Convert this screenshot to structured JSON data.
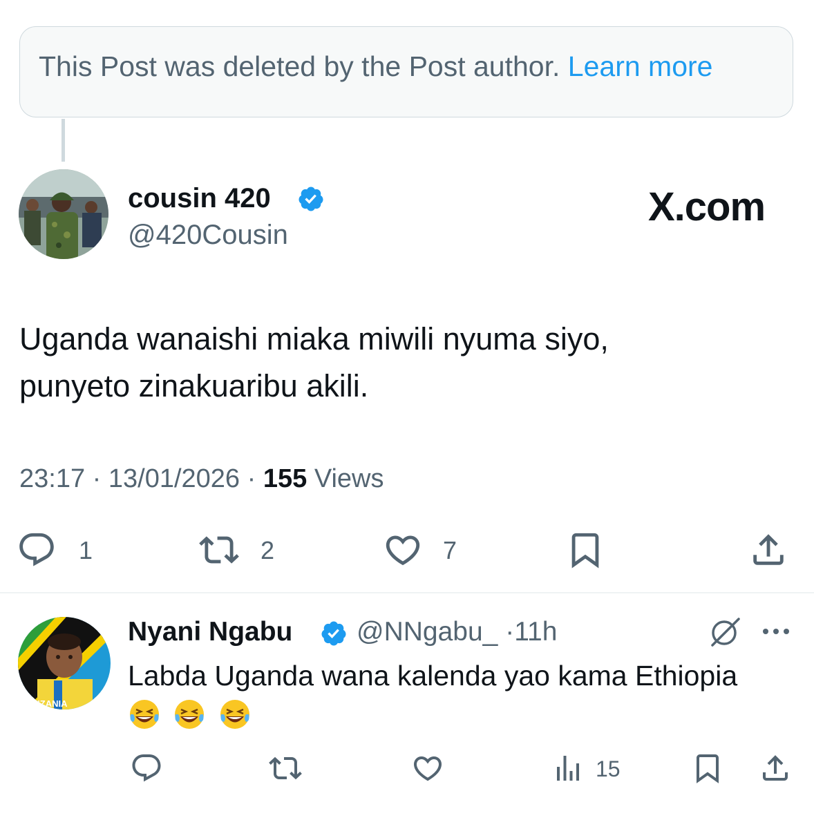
{
  "deleted_banner": {
    "text": "This Post was deleted by the Post author.",
    "link": "Learn more"
  },
  "brand": {
    "label": "X.com"
  },
  "post": {
    "display_name": "cousin 420",
    "handle": "@420Cousin",
    "text_line1": "Uganda wanaishi miaka miwili nyuma siyo,",
    "text_line2": "punyeto zinakuaribu akili.",
    "time": "23:17",
    "date": "13/01/2026",
    "views_count": "155",
    "views_label": "Views",
    "separator": "·",
    "actions": {
      "reply_count": "1",
      "repost_count": "2",
      "like_count": "7"
    }
  },
  "reply": {
    "display_name": "Nyani Ngabu",
    "handle": "@NNgabu_",
    "separator": "·",
    "time": "11h",
    "text": "Labda Uganda wana kalenda yao kama Ethiopia",
    "emoji_count": 3,
    "views_count": "15",
    "avatar_text": "TANZANIA"
  },
  "colors": {
    "accent": "#1d9bf0",
    "text_primary": "#0f1419",
    "text_secondary": "#536471",
    "banner_bg": "#f7f9f9",
    "border": "#cfd9de"
  }
}
